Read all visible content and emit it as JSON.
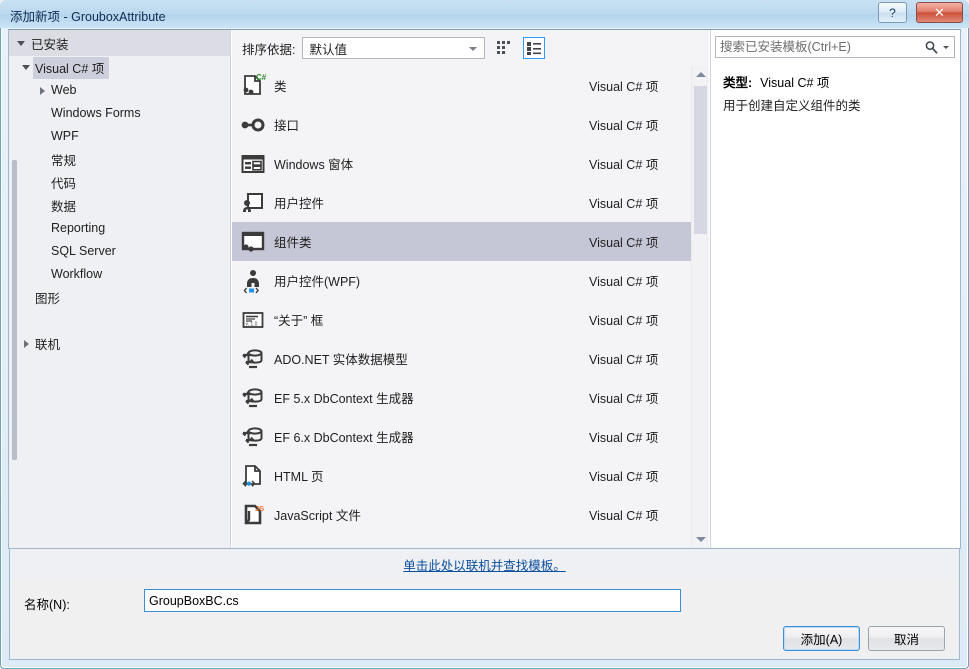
{
  "window": {
    "title": "添加新项 - GrouboxAttribute",
    "help_button": "?",
    "close_button": "✕"
  },
  "tree": {
    "header": "已安装",
    "items": [
      {
        "label": "Visual C# 项",
        "indent": 0,
        "twisty": "down",
        "selected": true
      },
      {
        "label": "Web",
        "indent": 1,
        "twisty": "right",
        "selected": false
      },
      {
        "label": "Windows Forms",
        "indent": 1,
        "twisty": "none",
        "selected": false
      },
      {
        "label": "WPF",
        "indent": 1,
        "twisty": "none",
        "selected": false
      },
      {
        "label": "常规",
        "indent": 1,
        "twisty": "none",
        "selected": false
      },
      {
        "label": "代码",
        "indent": 1,
        "twisty": "none",
        "selected": false
      },
      {
        "label": "数据",
        "indent": 1,
        "twisty": "none",
        "selected": false
      },
      {
        "label": "Reporting",
        "indent": 1,
        "twisty": "none",
        "selected": false
      },
      {
        "label": "SQL Server",
        "indent": 1,
        "twisty": "none",
        "selected": false
      },
      {
        "label": "Workflow",
        "indent": 1,
        "twisty": "none",
        "selected": false
      },
      {
        "label": "图形",
        "indent": 0,
        "twisty": "none",
        "selected": false
      },
      {
        "label": "",
        "indent": 0,
        "twisty": "none",
        "selected": false
      },
      {
        "label": "联机",
        "indent": 0,
        "twisty": "right",
        "selected": false
      }
    ]
  },
  "toolbar": {
    "sort_label": "排序依据:",
    "sort_value": "默认值",
    "view_medium_icons": "medium-icons-view",
    "view_list": "list-view"
  },
  "templates": {
    "kind_column": "Visual C# 项",
    "items": [
      {
        "name": "类",
        "kind": "Visual C# 项",
        "icon": "class-icon",
        "selected": false
      },
      {
        "name": "接口",
        "kind": "Visual C# 项",
        "icon": "interface-icon",
        "selected": false
      },
      {
        "name": "Windows 窗体",
        "kind": "Visual C# 项",
        "icon": "windows-form-icon",
        "selected": false
      },
      {
        "name": "用户控件",
        "kind": "Visual C# 项",
        "icon": "user-control-icon",
        "selected": false
      },
      {
        "name": "组件类",
        "kind": "Visual C# 项",
        "icon": "component-class-icon",
        "selected": true
      },
      {
        "name": "用户控件(WPF)",
        "kind": "Visual C# 项",
        "icon": "user-control-wpf-icon",
        "selected": false
      },
      {
        "name": "“关于” 框",
        "kind": "Visual C# 项",
        "icon": "about-box-icon",
        "selected": false
      },
      {
        "name": "ADO.NET 实体数据模型",
        "kind": "Visual C# 项",
        "icon": "ado-net-icon",
        "selected": false
      },
      {
        "name": "EF 5.x DbContext 生成器",
        "kind": "Visual C# 项",
        "icon": "ado-net-icon",
        "selected": false
      },
      {
        "name": "EF 6.x DbContext 生成器",
        "kind": "Visual C# 项",
        "icon": "ado-net-icon",
        "selected": false
      },
      {
        "name": "HTML 页",
        "kind": "Visual C# 项",
        "icon": "html-page-icon",
        "selected": false
      },
      {
        "name": "JavaScript 文件",
        "kind": "Visual C# 项",
        "icon": "javascript-file-icon",
        "selected": false
      }
    ]
  },
  "search": {
    "placeholder": "搜索已安装模板(Ctrl+E)",
    "value": ""
  },
  "details": {
    "type_label": "类型:",
    "type_value": "Visual C# 项",
    "description": "用于创建自定义组件的类"
  },
  "footer": {
    "online_link": "单击此处以联机并查找模板。",
    "name_label": "名称(N):",
    "name_value": "GroupBoxBC.cs",
    "add_button": "添加(A)",
    "cancel_button": "取消"
  },
  "colors": {
    "accent_blue": "#3b8fd6",
    "selection": "#c5c7d6",
    "link": "#0b4f9e",
    "close_red": "#cc513a"
  }
}
